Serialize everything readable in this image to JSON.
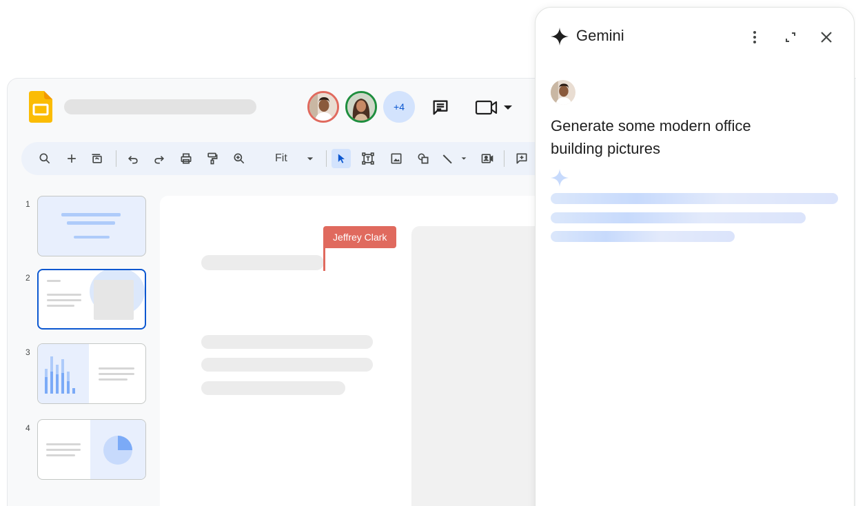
{
  "collaborators": {
    "avatars": [
      {
        "name": "collaborator-avatar-1",
        "ring_color": "#e06a5e"
      },
      {
        "name": "collaborator-avatar-2",
        "ring_color": "#1e8e3e"
      }
    ],
    "more_count": "+4"
  },
  "toolbar": {
    "zoom_value": "Fit",
    "icons": [
      "search-icon",
      "add-icon",
      "new-slide-icon",
      "undo-icon",
      "redo-icon",
      "print-icon",
      "paint-format-icon",
      "zoom-icon",
      "dropdown-icon",
      "select-cursor-icon",
      "text-box-icon",
      "image-icon",
      "shape-icon",
      "line-icon",
      "video-icon",
      "comment-add-icon"
    ]
  },
  "filmstrip": {
    "slides": [
      {
        "number": "1"
      },
      {
        "number": "2"
      },
      {
        "number": "3"
      },
      {
        "number": "4"
      }
    ]
  },
  "canvas": {
    "cursor_user": "Jeffrey Clark",
    "cursor_color": "#e06a5e"
  },
  "gemini": {
    "title": "Gemini",
    "prompt": "Generate some modern office building pictures"
  },
  "colors": {
    "accent": "#0b57d0",
    "accent_light": "#d3e3fd",
    "slides_yellow": "#fbbc04"
  }
}
